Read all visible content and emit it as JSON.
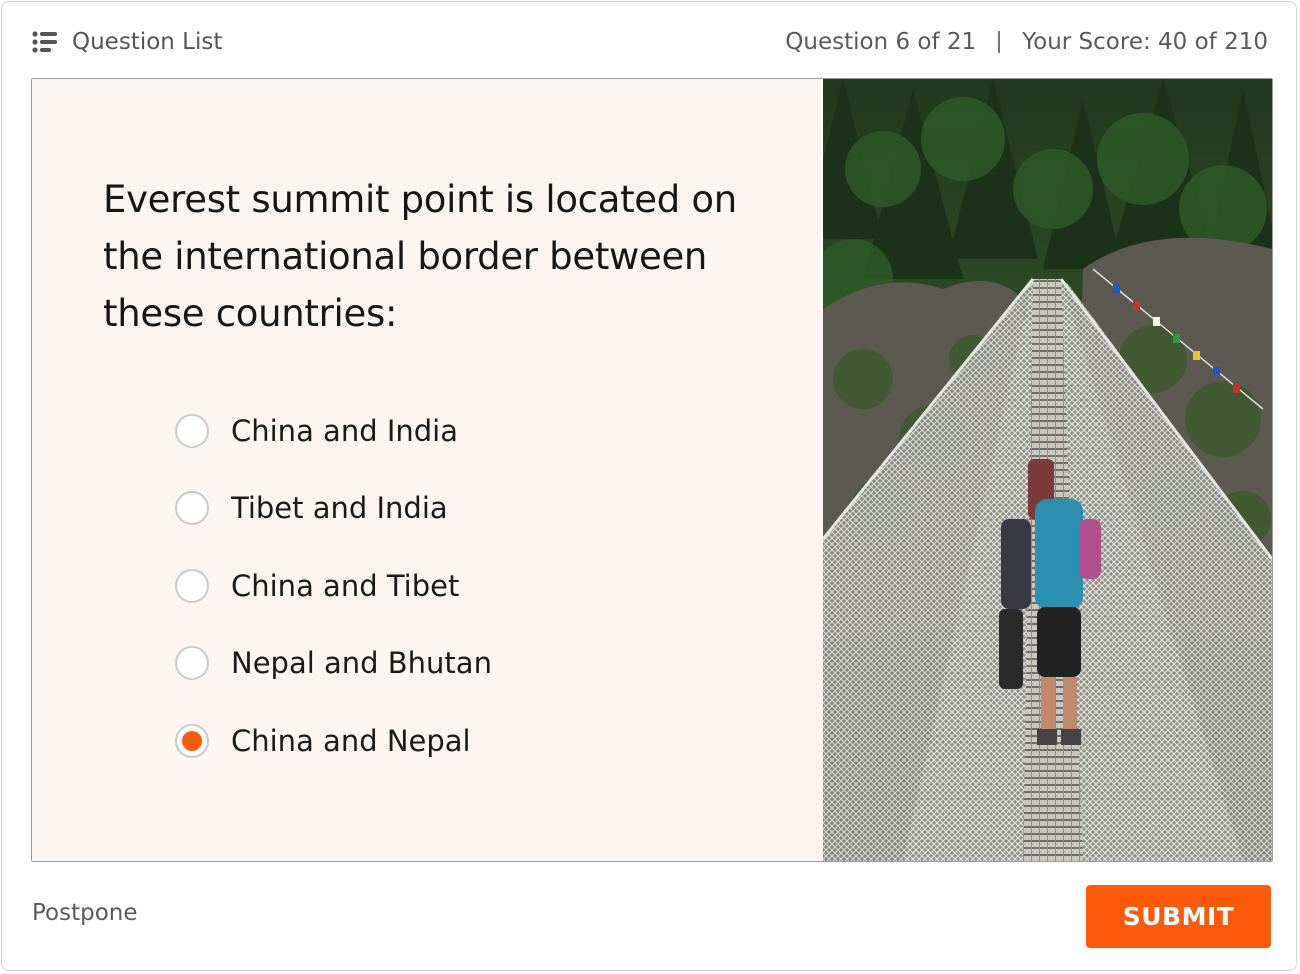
{
  "header": {
    "question_list_label": "Question List",
    "question_counter": "Question 6 of 21",
    "score": "Your Score: 40 of 210"
  },
  "question": {
    "text": "Everest summit point is located on the international border between these countries:",
    "options": [
      {
        "label": "China and India",
        "selected": false
      },
      {
        "label": "Tibet and India",
        "selected": false
      },
      {
        "label": "China and Tibet",
        "selected": false
      },
      {
        "label": "Nepal and Bhutan",
        "selected": false
      },
      {
        "label": "China and Nepal",
        "selected": true
      }
    ]
  },
  "image": {
    "subject": "hikers crossing a suspension bridge with prayer flags in a forested mountain valley"
  },
  "footer": {
    "postpone_label": "Postpone",
    "submit_label": "SUBMIT"
  },
  "colors": {
    "accent": "#fc5a0a",
    "question_panel_bg": "#fdf5f2"
  },
  "icons": {
    "question_list": "list-icon"
  }
}
